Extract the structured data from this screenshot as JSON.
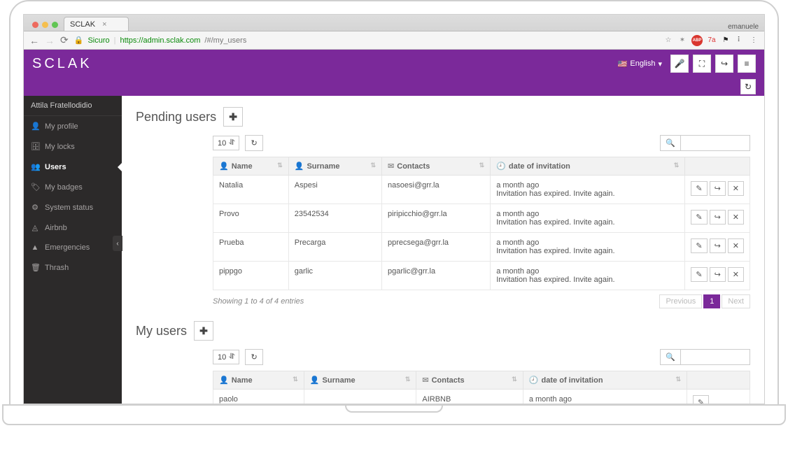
{
  "browser": {
    "tab_title": "SCLAK",
    "menu_user": "emanuele",
    "url_secure_label": "Sicuro",
    "url_host": "https://admin.sclak.com",
    "url_path": "/#/my_users",
    "traffic_colors": {
      "close": "#ed6a5e",
      "min": "#f5bf4f",
      "max": "#61c554"
    },
    "extensions": [
      {
        "name": "star-icon",
        "glyph": "☆",
        "color": "#888"
      },
      {
        "name": "wand-icon",
        "glyph": "✶",
        "color": "#888"
      },
      {
        "name": "abp-icon",
        "glyph": "ABP",
        "color": "#fff",
        "bg": "#d9362f"
      },
      {
        "name": "lang-icon",
        "glyph": "7a",
        "color": "#d33"
      },
      {
        "name": "flag-icon",
        "glyph": "⚑",
        "color": "#222"
      },
      {
        "name": "dots-icon",
        "glyph": "⠇",
        "color": "#555"
      },
      {
        "name": "menu-icon",
        "glyph": "⋮",
        "color": "#555"
      }
    ]
  },
  "app": {
    "brand": "SCLAK",
    "language_label": "English",
    "top_buttons": [
      {
        "name": "mic-icon",
        "glyph": "🎤"
      },
      {
        "name": "fullscreen-icon",
        "glyph": "⛶"
      },
      {
        "name": "logout-icon",
        "glyph": "↪"
      },
      {
        "name": "menu-icon",
        "glyph": "≡"
      }
    ],
    "subbar_button": {
      "name": "refresh-icon",
      "glyph": "↻"
    }
  },
  "sidebar": {
    "user_name": "Attila Fratellodidio",
    "items": [
      {
        "icon": "user",
        "label": "My profile",
        "active": false
      },
      {
        "icon": "locks",
        "label": "My locks",
        "active": false
      },
      {
        "icon": "users",
        "label": "Users",
        "active": true
      },
      {
        "icon": "badges",
        "label": "My badges",
        "active": false
      },
      {
        "icon": "status",
        "label": "System status",
        "active": false
      },
      {
        "icon": "airbnb",
        "label": "Airbnb",
        "active": false
      },
      {
        "icon": "alert",
        "label": "Emergencies",
        "active": false
      },
      {
        "icon": "trash",
        "label": "Thrash",
        "active": false
      }
    ]
  },
  "pending": {
    "title": "Pending users",
    "page_size": "10",
    "columns": {
      "name": "Name",
      "surname": "Surname",
      "contacts": "Contacts",
      "date": "date of invitation"
    },
    "rows": [
      {
        "name": "Natalia",
        "surname": "Aspesi",
        "contacts": "nasoesi@grr.la",
        "date": "a month ago",
        "note": "Invitation has expired. Invite again."
      },
      {
        "name": "Provo",
        "surname": "23542534",
        "contacts": "piripicchio@grr.la",
        "date": "a month ago",
        "note": "Invitation has expired. Invite again."
      },
      {
        "name": "Prueba",
        "surname": "Precarga",
        "contacts": "pprecsega@grr.la",
        "date": "a month ago",
        "note": "Invitation has expired. Invite again."
      },
      {
        "name": "pippgo",
        "surname": "garlic",
        "contacts": "pgarlic@grr.la",
        "date": "a month ago",
        "note": "Invitation has expired. Invite again."
      }
    ],
    "info": "Showing 1 to 4 of 4 entries",
    "pager": {
      "prev": "Previous",
      "page": "1",
      "next": "Next"
    }
  },
  "myusers": {
    "title": "My users",
    "page_size": "10",
    "columns": {
      "name": "Name",
      "surname": "Surname",
      "contacts": "Contacts",
      "date": "date of invitation"
    },
    "rows": [
      {
        "name": "paolo",
        "surname": "",
        "contacts": "AIRBNB",
        "date": "a month ago"
      }
    ]
  },
  "icons": {
    "user": "👤",
    "locks": "🗄",
    "users": "👥",
    "badges": "🏷",
    "status": "⚙",
    "airbnb": "◬",
    "alert": "▲",
    "trash": "🗑",
    "plus": "✚",
    "refresh": "↻",
    "search": "🔍",
    "sort": "⇅",
    "clock": "🕘",
    "mail": "✉",
    "person": "👤",
    "edit": "✎",
    "resend": "↪",
    "delete": "✕",
    "chevron-left": "‹",
    "updown": "⥯"
  }
}
